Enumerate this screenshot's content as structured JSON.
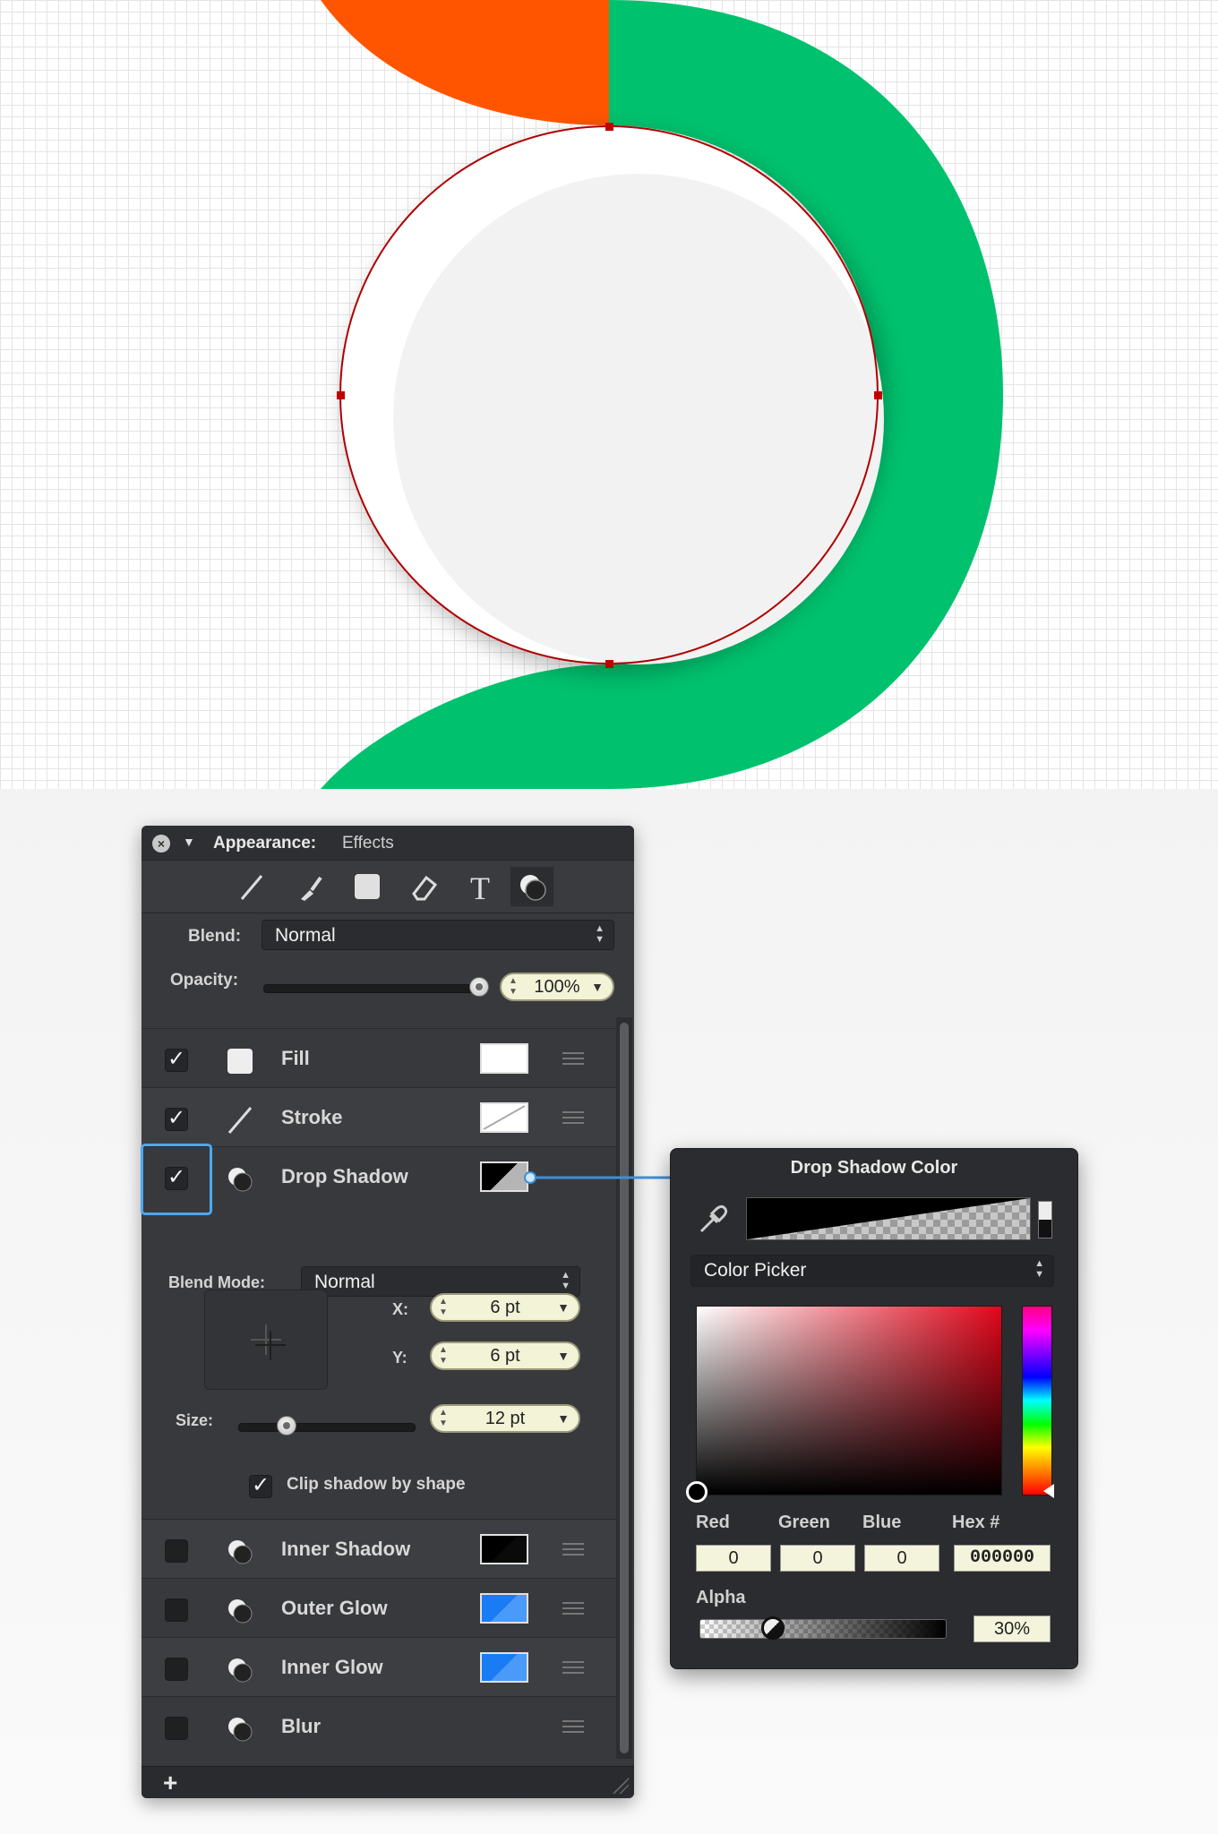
{
  "canvas": {
    "colors": {
      "orange": "#ff5500",
      "green": "#00c26e",
      "circle_fill": "#ffffff",
      "inner_fill": "#f2f2f2",
      "path_stroke": "#b00000",
      "grid": "#e4e4e4"
    }
  },
  "appearance": {
    "title": "Appearance:",
    "subtitle": "Effects",
    "tabs": [
      "stroke-tab",
      "brush-tab",
      "fill-tab",
      "eraser-tab",
      "text-tab",
      "effects-tab"
    ],
    "text_tab_glyph": "T",
    "blend": {
      "label": "Blend:",
      "value": "Normal"
    },
    "opacity": {
      "label": "Opacity:",
      "value": "100%",
      "level": 1.0
    },
    "effects": [
      {
        "label": "Fill",
        "checked": true,
        "swatch": "#ffffff"
      },
      {
        "label": "Stroke",
        "checked": true,
        "swatch": "none"
      },
      {
        "label": "Drop Shadow",
        "checked": true,
        "swatch": "#000000"
      },
      {
        "label": "Inner Shadow",
        "checked": false,
        "swatch": "#000000"
      },
      {
        "label": "Outer Glow",
        "checked": false,
        "swatch": "#1a7cf5"
      },
      {
        "label": "Inner Glow",
        "checked": false,
        "swatch": "#1a7cf5"
      },
      {
        "label": "Blur",
        "checked": false,
        "swatch": null
      }
    ],
    "check_mark": "✓",
    "drop_shadow": {
      "blend_mode_label": "Blend Mode:",
      "blend_mode_value": "Normal",
      "x_label": "X:",
      "x_value": "6 pt",
      "y_label": "Y:",
      "y_value": "6 pt",
      "size_label": "Size:",
      "size_value": "12 pt",
      "size_level": 0.27,
      "clip_label": "Clip shadow by shape",
      "clip_checked": true
    },
    "add_label": "+"
  },
  "color_popover": {
    "title": "Drop Shadow Color",
    "picker_mode": "Color Picker",
    "labels": {
      "red": "Red",
      "green": "Green",
      "blue": "Blue",
      "hex": "Hex #",
      "alpha": "Alpha"
    },
    "values": {
      "red": "0",
      "green": "0",
      "blue": "0",
      "hex": "000000",
      "alpha": "30%"
    },
    "alpha_level": 0.3,
    "hue_color": "#e1061a"
  }
}
